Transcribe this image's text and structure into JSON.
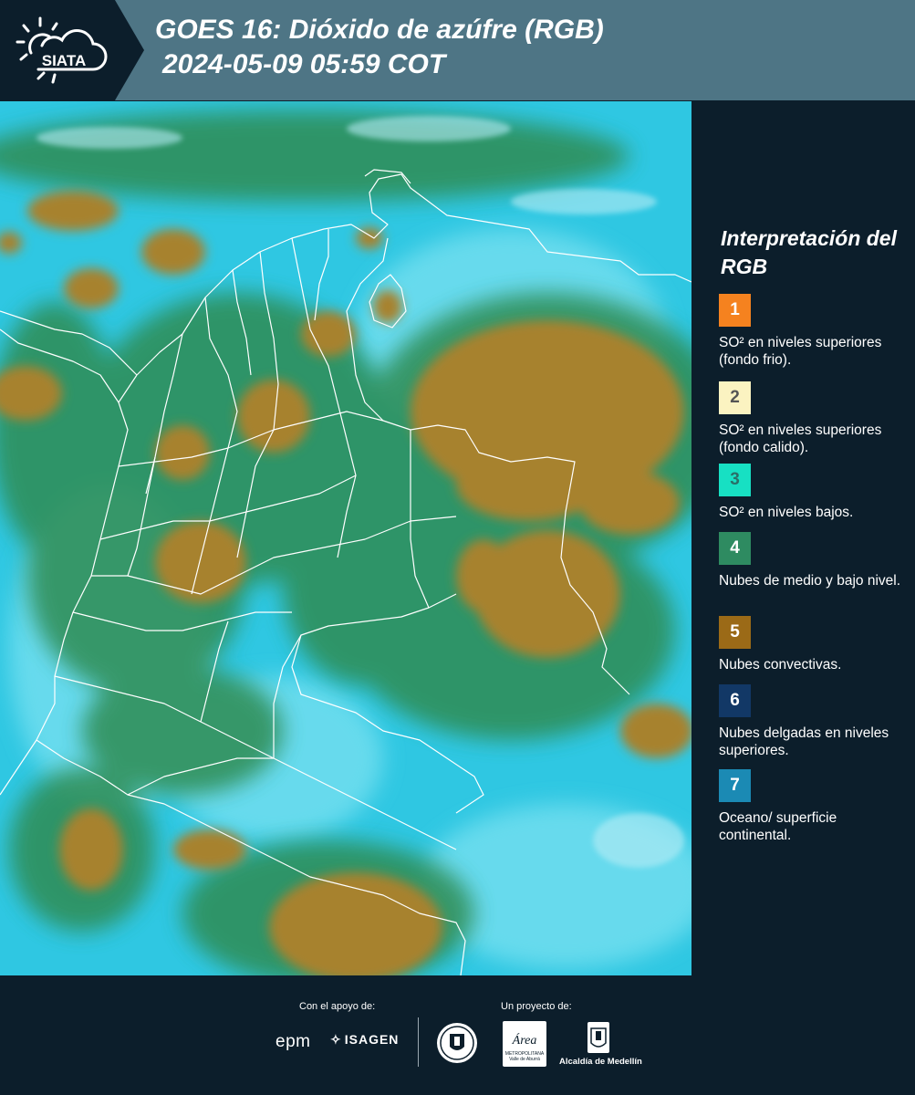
{
  "header": {
    "logo_text": "SIATA",
    "title_line1": "GOES 16: Dióxido de azúfre (RGB)",
    "title_line2": "2024-05-09 05:59 COT"
  },
  "colors": {
    "header_bg": "#4e7585",
    "dark_bg": "#0c1e2b",
    "sky_cyan": "#2fc9e3",
    "low_cloud_green": "#2f8f55",
    "convective_brown": "#a7822e",
    "border_lines": "#ffffff"
  },
  "legend": {
    "title": "Interpretación del RGB",
    "items": [
      {
        "number": "1",
        "color": "#f5821f",
        "text": "SO² en niveles superiores (fondo frio)."
      },
      {
        "number": "2",
        "color": "#fbf3c1",
        "text": "SO² en niveles superiores (fondo calido)."
      },
      {
        "number": "3",
        "color": "#17e0c3",
        "text": "SO² en niveles bajos."
      },
      {
        "number": "4",
        "color": "#2e8b61",
        "text": "Nubes de medio y bajo nivel."
      },
      {
        "number": "5",
        "color": "#9b6a17",
        "text": "Nubes convectivas."
      },
      {
        "number": "6",
        "color": "#123866",
        "text": "Nubes delgadas en niveles superiores."
      },
      {
        "number": "7",
        "color": "#1b8ab4",
        "text": "Oceano/ superficie continental."
      }
    ]
  },
  "footer": {
    "support_label": "Con el apoyo de:",
    "project_label": "Un proyecto de:",
    "sponsor1": "epm",
    "sponsor2": "ISAGEN",
    "partner1_name": "Área",
    "partner1_sub": "METROPOLITANA Valle de Aburrá",
    "partner2_name": "Alcaldía de Medellín"
  }
}
